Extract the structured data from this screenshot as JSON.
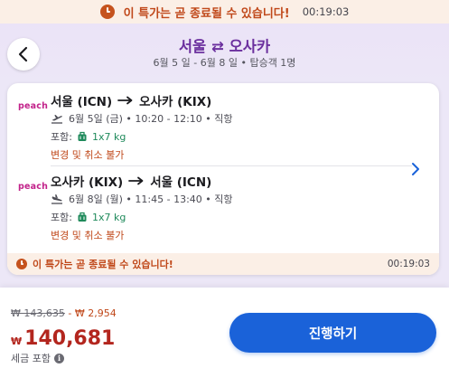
{
  "top_banner": {
    "icon": "clock-icon",
    "text": "이 특가는 곧 종료될 수 있습니다!",
    "countdown": "00:19:03",
    "accent_color": "#c0481a"
  },
  "header": {
    "back_icon": "chevron-left-icon",
    "route_from": "서울",
    "route_swap": "⇄",
    "route_to": "오사카",
    "subtitle": "6월 5 일 - 6월 8 일 • 탑승객 1명",
    "title_color": "#6b2f9e"
  },
  "itinerary": {
    "legs": [
      {
        "airline": "peach",
        "from": "서울 (ICN)",
        "to": "오사카 (KIX)",
        "direction_icon": "plane-takeoff-icon",
        "schedule": "6월 5일 (금) • 10:20 - 12:10 • 직항",
        "baggage_label": "포함:",
        "baggage_value": "1x7 kg",
        "policy": "변경 및 취소 불가"
      },
      {
        "airline": "peach",
        "from": "오사카 (KIX)",
        "to": "서울 (ICN)",
        "direction_icon": "plane-landing-icon",
        "schedule": "6월 8일 (월) • 11:45 - 13:40 • 직항",
        "baggage_label": "포함:",
        "baggage_value": "1x7 kg",
        "policy": "변경 및 취소 불가"
      }
    ],
    "expand_icon": "chevron-right-icon",
    "deal_banner": {
      "text": "이 특가는 곧 종료될 수 있습니다!",
      "countdown": "00:19:03"
    }
  },
  "pricing": {
    "original_price": "₩ 143,635",
    "discount": "- ₩ 2,954",
    "currency_symbol": "₩",
    "final_price": "140,681",
    "tax_note": "세금 포함",
    "info_icon": "info-icon",
    "price_color": "#b3261e"
  },
  "actions": {
    "proceed_label": "진행하기",
    "proceed_color": "#1a62d9"
  }
}
